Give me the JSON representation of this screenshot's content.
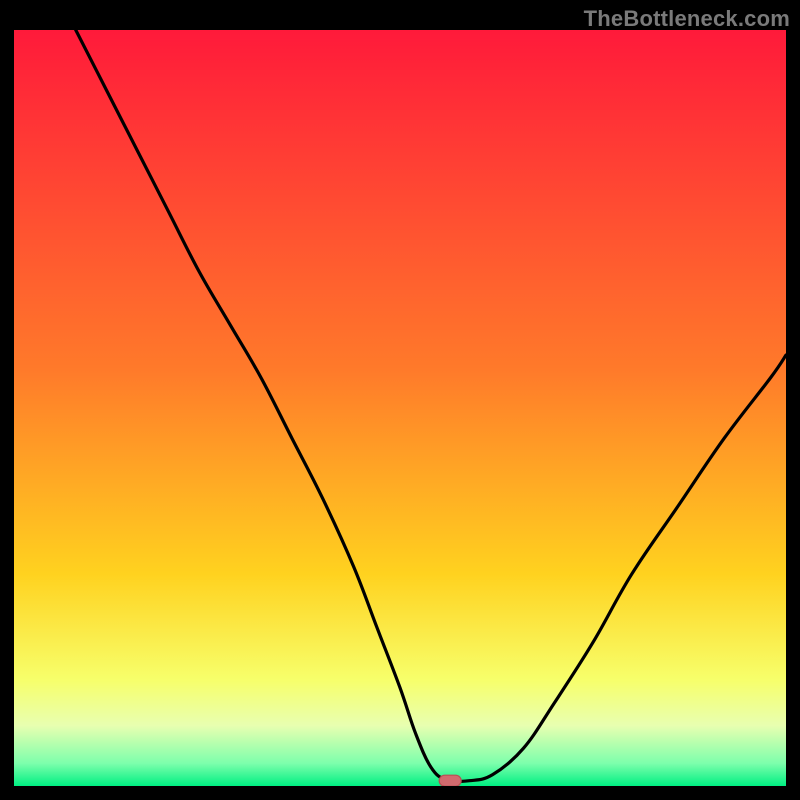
{
  "watermark": "TheBottleneck.com",
  "colors": {
    "bg": "#000000",
    "gradient_top": "#ff1a3a",
    "gradient_mid1": "#ff7a2a",
    "gradient_mid2": "#ffd21f",
    "gradient_low": "#f7ff6b",
    "gradient_band": "#e8ffb0",
    "gradient_bottom": "#00ef82",
    "curve": "#000000",
    "marker_fill": "#d16a6e",
    "marker_stroke": "#b94f54"
  },
  "chart_data": {
    "type": "line",
    "title": "",
    "xlabel": "",
    "ylabel": "",
    "xlim": [
      0,
      100
    ],
    "ylim": [
      0,
      100
    ],
    "curve": {
      "name": "bottleneck-curve",
      "x": [
        8,
        12,
        16,
        20,
        24,
        28,
        32,
        36,
        40,
        44,
        47,
        50,
        52,
        54,
        56,
        59,
        62,
        66,
        70,
        75,
        80,
        86,
        92,
        98,
        100
      ],
      "y": [
        100,
        92,
        84,
        76,
        68,
        61,
        54,
        46,
        38,
        29,
        21,
        13,
        7,
        2.5,
        0.8,
        0.7,
        1.5,
        5,
        11,
        19,
        28,
        37,
        46,
        54,
        57
      ]
    },
    "minimum_marker": {
      "x": 56.5,
      "y": 0.7
    },
    "gradient_bands_y": [
      0,
      75,
      82,
      88,
      93,
      96,
      100
    ]
  }
}
